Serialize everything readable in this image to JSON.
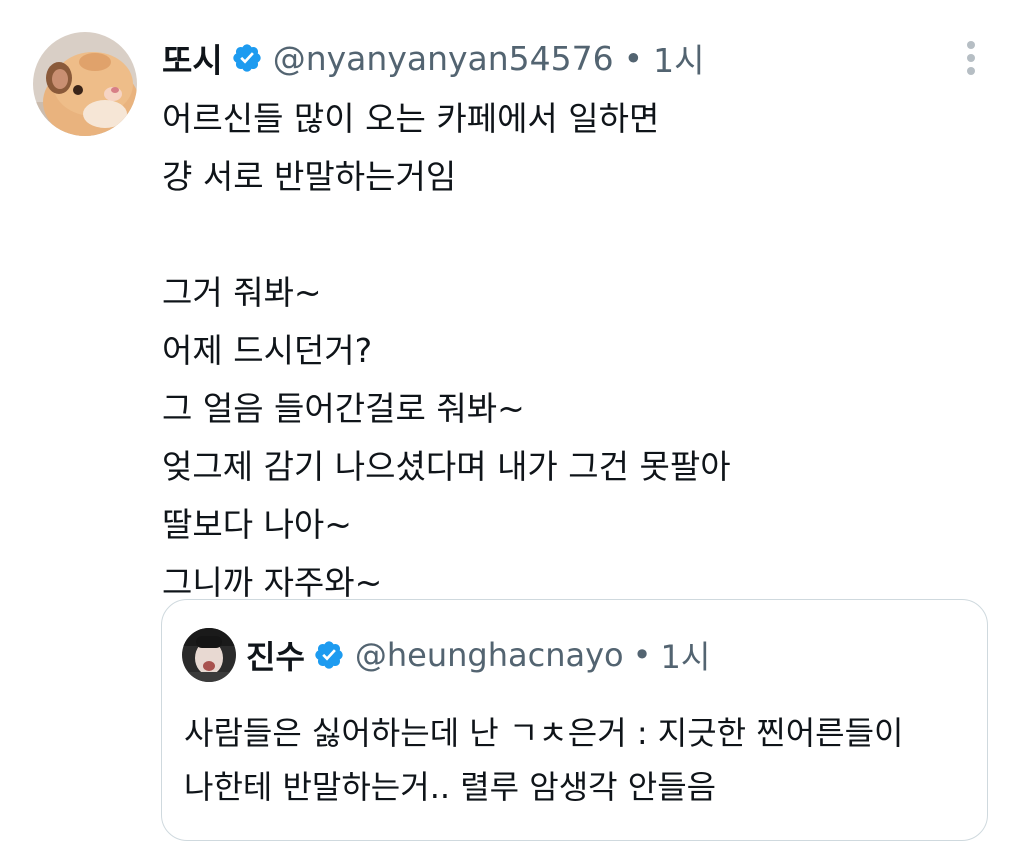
{
  "tweet": {
    "author": {
      "display_name": "또시",
      "handle": "@nyanyanyan54576",
      "verified": true,
      "avatar": "hamster-avatar"
    },
    "separator": "•",
    "time": "1시",
    "more_icon": "more-vertical-icon",
    "lines": [
      "어르신들 많이 오는 카페에서 일하면",
      "걍 서로 반말하는거임",
      "",
      "그거 줘봐~",
      "어제 드시던거?",
      "그 얼음 들어간걸로 줘봐~",
      "엊그제 감기 나으셨다며 내가 그건 못팔아",
      "딸보다 나아~",
      "그니까 자주와~"
    ]
  },
  "quote": {
    "author": {
      "display_name": "진수",
      "handle": "@heunghacnayo",
      "verified": true,
      "avatar": "person-avatar"
    },
    "separator": "•",
    "time": "1시",
    "lines": [
      "사람들은 싫어하는데 난 ㄱㅊ은거 : 지긋한 찐어른들이",
      "나한테 반말하는거.. 렬루 암생각 안들음"
    ]
  },
  "colors": {
    "text": "#0f1419",
    "secondary": "#536471",
    "verified_blue": "#1d9bf0",
    "border": "#cfd9de"
  }
}
